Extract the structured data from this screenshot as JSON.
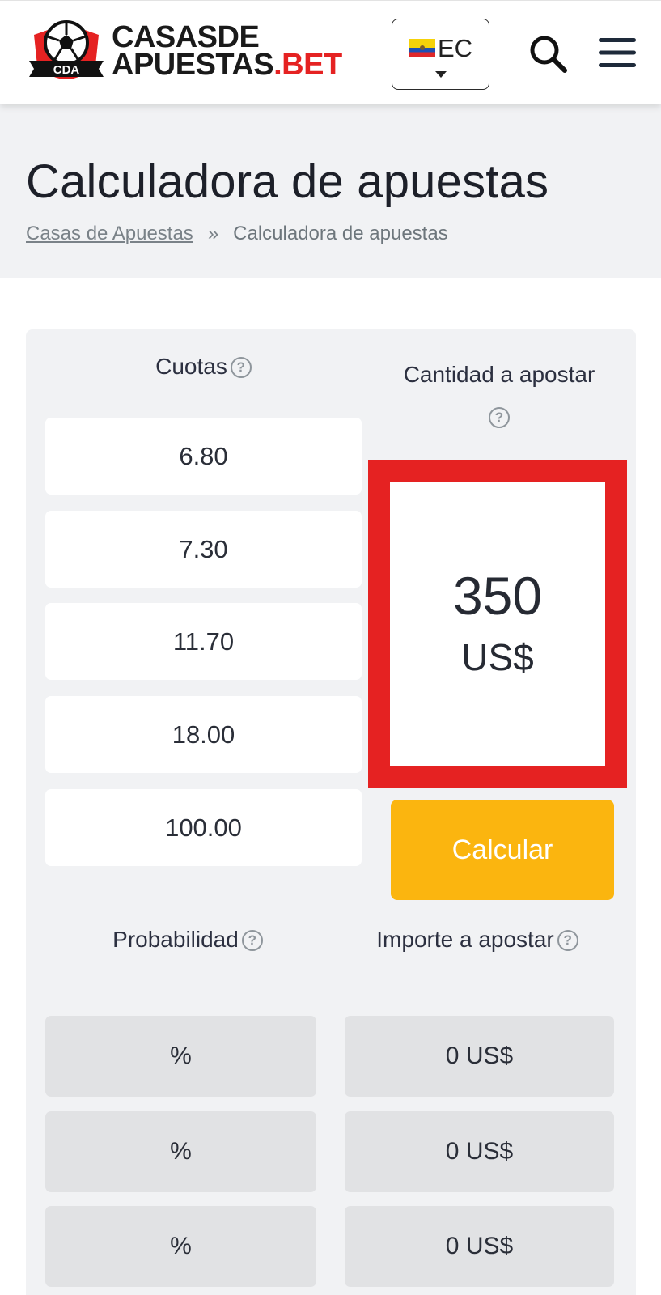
{
  "header": {
    "logo": {
      "badge_text": "CDA",
      "line1_main": "CASAS",
      "line1_light": "DE",
      "line2_main": "APUESTAS",
      "line2_accent": ".BET"
    },
    "language": {
      "code": "EC",
      "flag": "ecuador-flag-icon"
    },
    "icons": {
      "search": "search-icon",
      "menu": "hamburger-menu-icon"
    }
  },
  "page": {
    "title": "Calculadora de apuestas",
    "breadcrumb": {
      "home": "Casas de Apuestas",
      "separator": "»",
      "current": "Calculadora de apuestas"
    }
  },
  "calculator": {
    "odds_label": "Cuotas",
    "stake_label": "Cantidad a apostar",
    "help_glyph": "?",
    "odds": [
      "6.80",
      "7.30",
      "11.70",
      "18.00",
      "100.00"
    ],
    "stake": {
      "value": "350",
      "currency": "US$"
    },
    "calculate_label": "Calcular",
    "probability_label": "Probabilidad",
    "amount_label": "Importe a apostar",
    "probabilities": [
      "%",
      "%",
      "%"
    ],
    "amounts": [
      "0 US$",
      "0 US$",
      "0 US$"
    ]
  },
  "colors": {
    "brand_red": "#e52222",
    "button_yellow": "#fbb50f",
    "panel_bg": "#f1f2f4",
    "result_bg": "#e1e2e4"
  }
}
